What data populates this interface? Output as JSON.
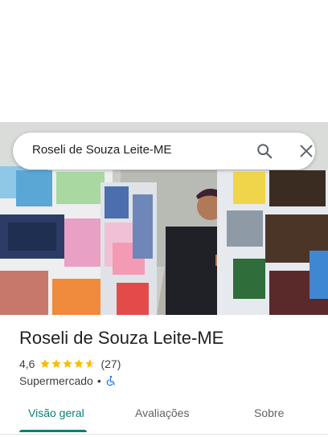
{
  "search": {
    "query": "Roseli de Souza Leite-ME"
  },
  "place": {
    "name": "Roseli de Souza Leite-ME",
    "rating": "4,6",
    "stars": 4.6,
    "review_count": "(27)",
    "category": "Supermercado",
    "separator": "•"
  },
  "tabs": [
    {
      "label": "Visão geral"
    },
    {
      "label": "Avaliações"
    },
    {
      "label": "Sobre"
    }
  ],
  "colors": {
    "accent": "#0b7f72",
    "star": "#fbbc04",
    "accessible": "#1a73e8"
  },
  "icons": [
    "search-icon",
    "close-icon",
    "star-icon",
    "wheelchair-icon"
  ]
}
